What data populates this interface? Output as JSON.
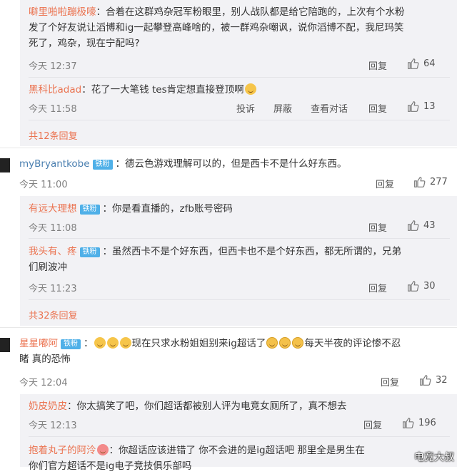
{
  "thread1": {
    "reply_a": {
      "user": "噼里啪啦蹦极嚎",
      "text_line1": "：合着在这群鸡杂冠军粉眼里，别人战队都是给它陪跑的，上次有个水粉",
      "text_line2": "发了个好友说让滔博和ig一起攀登高峰啥的，被一群鸡杂嘲讽，说你滔博不配，我尼玛笑",
      "text_line3": "死了，鸡杂，现在宁配吗?",
      "time": "今天 12:37",
      "reply_label": "回复",
      "likes": "64"
    },
    "reply_b": {
      "user": "黑科比adad",
      "text": "：花了一大笔钱 tes肯定想直接登顶啊",
      "time": "今天 11:58",
      "report_label": "投诉",
      "block_label": "屏蔽",
      "view_label": "查看对话",
      "reply_label": "回复",
      "likes": "13"
    },
    "more": "共12条回复"
  },
  "comment2": {
    "user": "myBryantkobe",
    "badge": "铁粉",
    "text": "：德云色游戏理解可以的，但是西卡不是什么好东西。",
    "time": "今天 11:00",
    "reply_label": "回复",
    "likes": "277",
    "replies": [
      {
        "user": "有远大理想",
        "badge": "铁粉",
        "text": "：你是看直播的，zfb账号密码",
        "time": "今天 11:08",
        "reply_label": "回复",
        "likes": "43"
      },
      {
        "user": "我头有、疼",
        "badge": "铁粉",
        "text_line1": "：虽然西卡不是个好东西，但西卡也不是个好东西，都无所谓的，兄弟",
        "text_line2": "们刷波冲",
        "time": "今天 11:23",
        "reply_label": "回复",
        "likes": "30"
      }
    ],
    "more": "共32条回复"
  },
  "comment3": {
    "user": "星星嘟阿",
    "badge": "铁粉",
    "text_a": "现在只求水粉姐姐别来ig超话了",
    "text_b": "每天半夜的评论惨不忍",
    "text_line2": "睹 真的恐怖",
    "time": "今天 12:04",
    "reply_label": "回复",
    "likes": "32",
    "replies": [
      {
        "user": "奶皮奶皮",
        "text": "：你太搞笑了吧，你们超话都被别人评为电竞女厕所了，真不想去",
        "time": "今天 12:13",
        "reply_label": "回复",
        "likes": "196"
      },
      {
        "user": "抱着丸子的阿泠",
        "text": "：你超话应该进错了 你不会进的是ig超话吧  那里全是男生在",
        "text_line2": "你们官方超话不是ig电子竞技俱乐部吗"
      }
    ]
  },
  "watermark": "电竞大叔",
  "colors": {
    "username": "#eb7350",
    "link_blue": "#4a7fb0",
    "reply_bg": "#f2f2f5",
    "badge": "#4fb0e8"
  }
}
